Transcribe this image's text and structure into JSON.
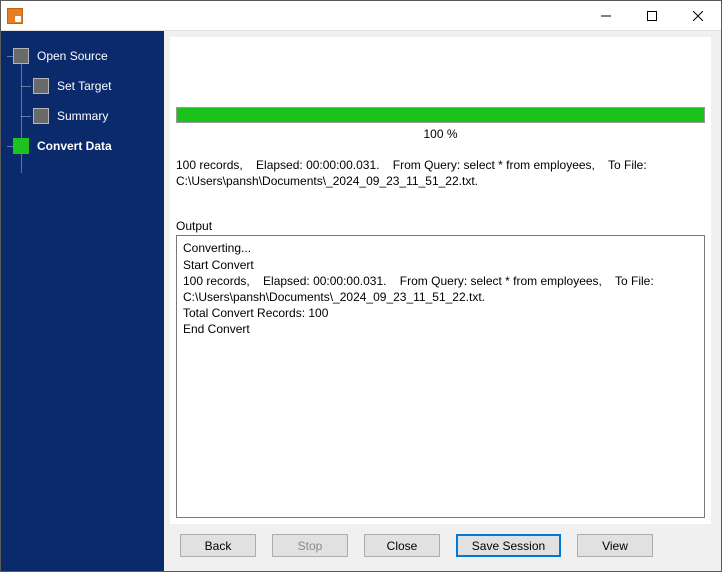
{
  "window": {
    "title": ""
  },
  "nav": {
    "items": [
      {
        "label": "Open Source"
      },
      {
        "label": "Set Target"
      },
      {
        "label": "Summary"
      },
      {
        "label": "Convert Data"
      }
    ]
  },
  "progress": {
    "percent_label": "100 %"
  },
  "status_text": "100 records,    Elapsed: 00:00:00.031.    From Query: select * from employees,    To File: C:\\Users\\pansh\\Documents\\_2024_09_23_11_51_22.txt.",
  "output": {
    "label": "Output",
    "text": "Converting...\nStart Convert\n100 records,    Elapsed: 00:00:00.031.    From Query: select * from employees,    To File: C:\\Users\\pansh\\Documents\\_2024_09_23_11_51_22.txt.\nTotal Convert Records: 100\nEnd Convert"
  },
  "buttons": {
    "back": "Back",
    "stop": "Stop",
    "close": "Close",
    "save_session": "Save Session",
    "view": "View"
  }
}
